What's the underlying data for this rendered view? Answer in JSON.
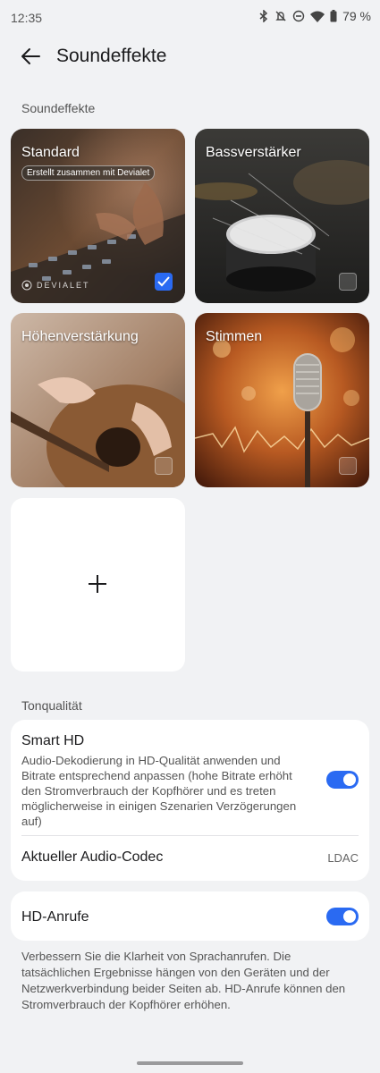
{
  "status": {
    "time": "12:35",
    "battery": "79 %"
  },
  "header": {
    "title": "Soundeffekte"
  },
  "effects_section": {
    "label": "Soundeffekte",
    "tiles": [
      {
        "title": "Standard",
        "subtitle": "Erstellt zusammen mit Devialet",
        "brand": "DEVIALET",
        "selected": true
      },
      {
        "title": "Bassverstärker",
        "selected": false
      },
      {
        "title": "Höhenverstärkung",
        "selected": false
      },
      {
        "title": "Stimmen",
        "selected": false
      }
    ],
    "add_icon": "plus-icon"
  },
  "quality_section": {
    "label": "Tonqualität",
    "smart_hd": {
      "title": "Smart HD",
      "description": "Audio-Dekodierung in HD-Qualität anwenden und Bitrate entsprechend anpassen (hohe Bitrate erhöht den Stromverbrauch der Kopfhörer und es treten möglicherweise in einigen Szenarien Verzögerungen auf)",
      "enabled": true
    },
    "codec": {
      "title": "Aktueller Audio-Codec",
      "value": "LDAC"
    }
  },
  "hd_calls": {
    "title": "HD-Anrufe",
    "enabled": true,
    "note": "Verbessern Sie die Klarheit von Sprachanrufen. Die tatsächlichen Ergebnisse hängen von den Geräten und der Netzwerkverbindung beider Seiten ab. HD-Anrufe können den Stromverbrauch der Kopfhörer erhöhen."
  },
  "colors": {
    "accent": "#2a6af2",
    "background": "#f1f2f4",
    "card": "#ffffff"
  }
}
